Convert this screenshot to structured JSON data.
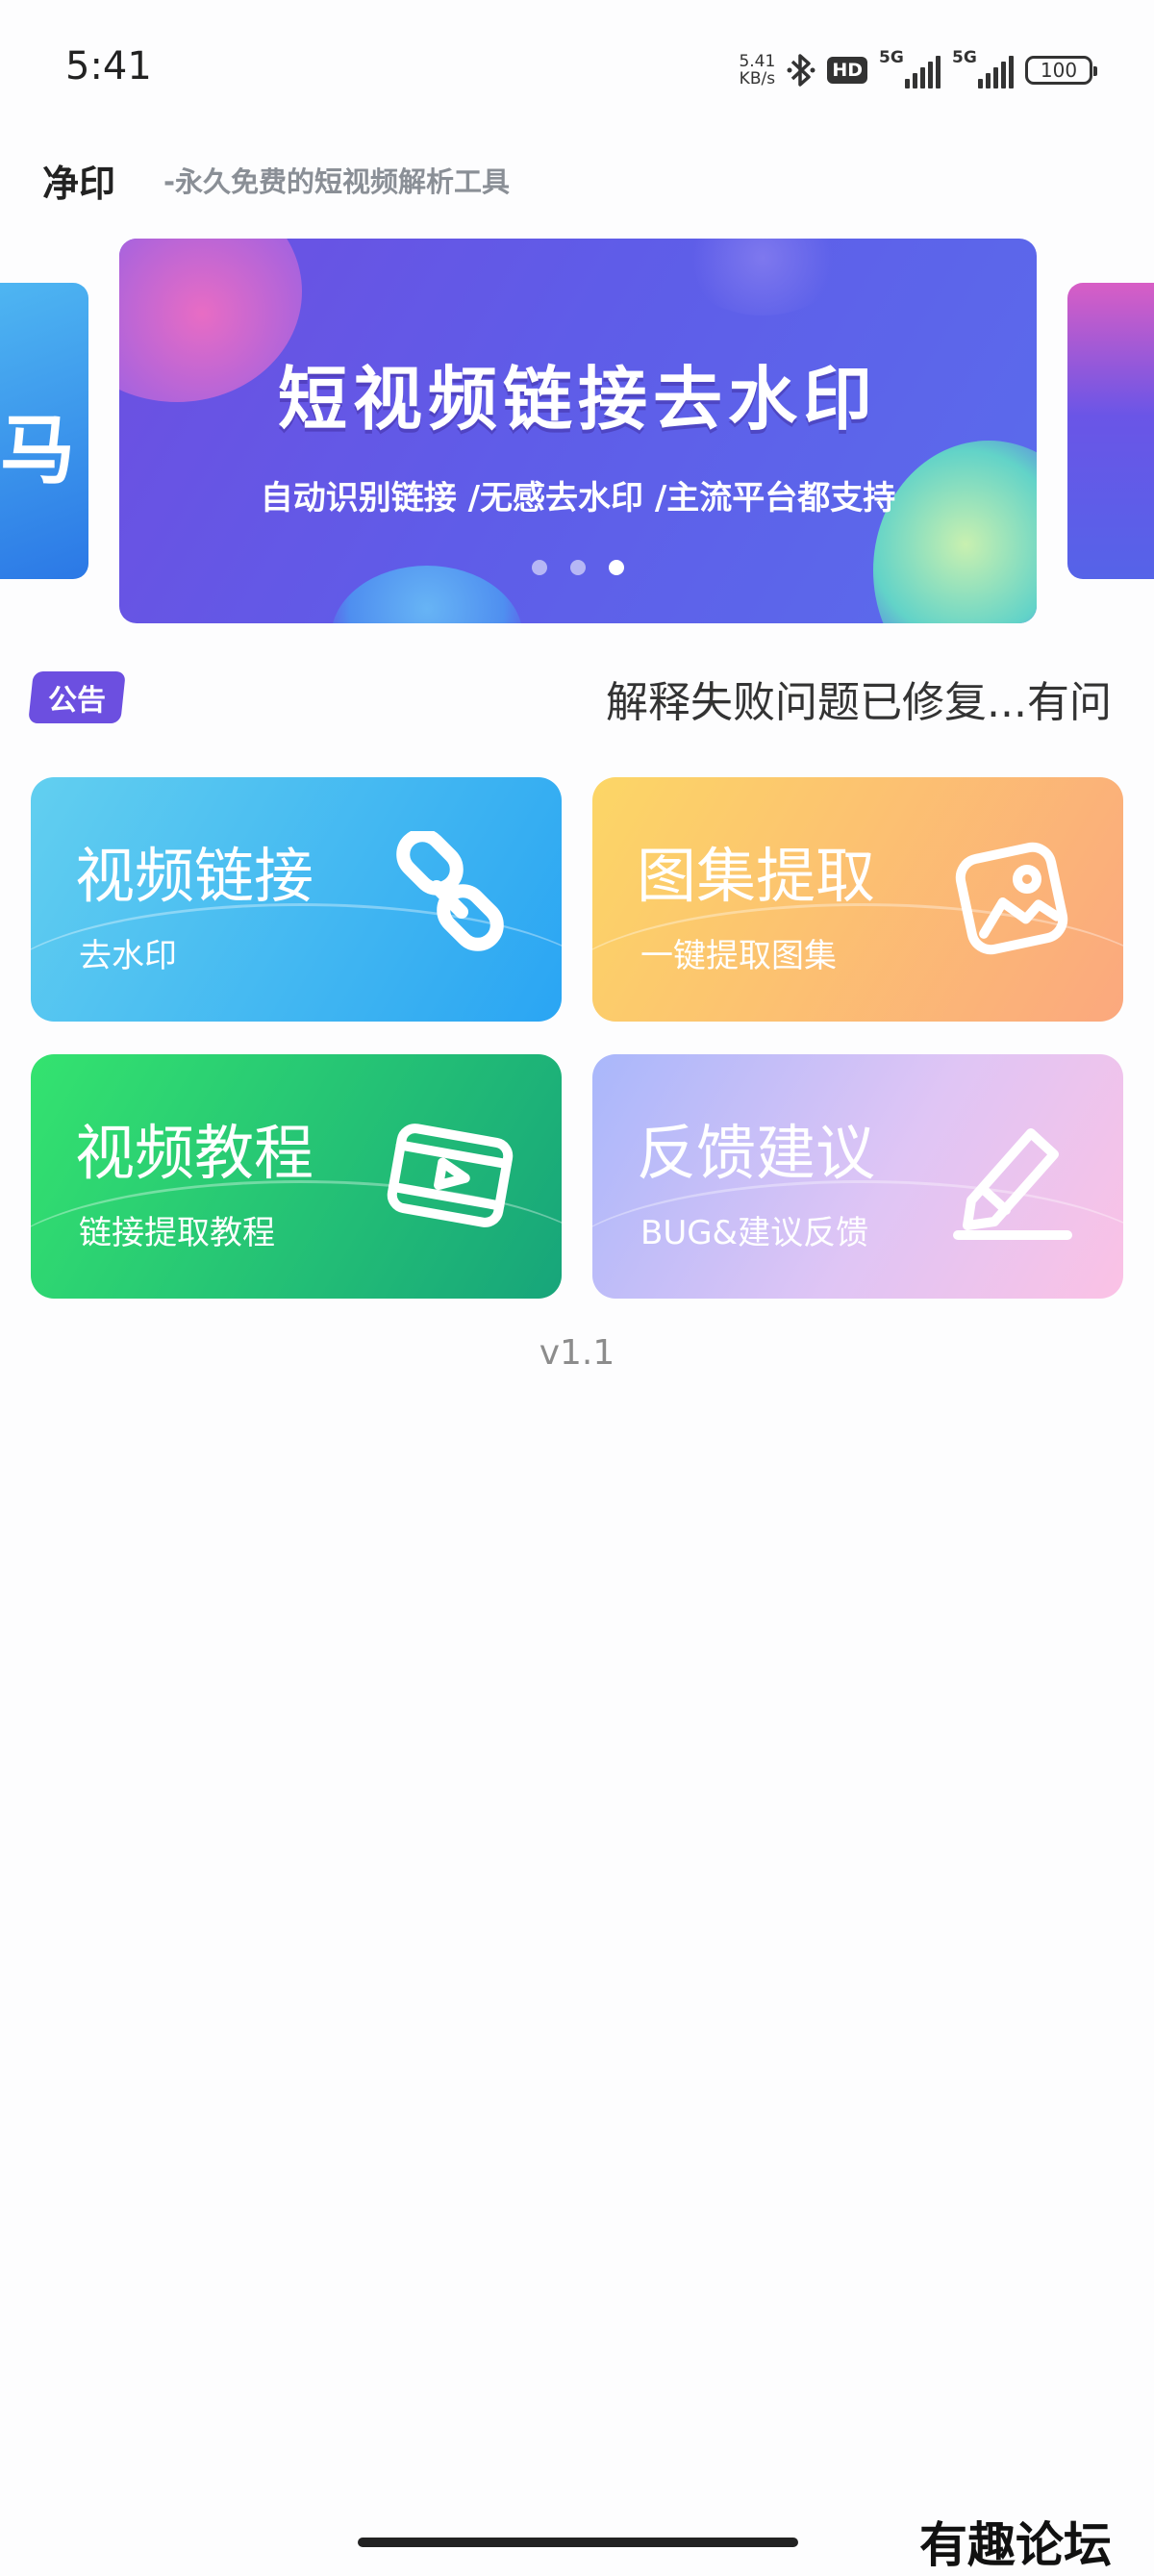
{
  "status_bar": {
    "time": "5:41",
    "net_speed_value": "5.41",
    "net_speed_unit": "KB/s",
    "hd_label": "HD",
    "sim1_label": "5G",
    "sim2_label": "5G",
    "battery": "100"
  },
  "header": {
    "title": "净印",
    "subtitle": "-永久免费的短视频解析工具"
  },
  "banner": {
    "title": "短视频链接去水印",
    "subtitle": "自动识别链接 /无感去水印 /主流平台都支持",
    "left_peek_text": "马",
    "slide_count": 3,
    "active_slide": 3
  },
  "notice": {
    "badge": "公告",
    "text": "解释失败问题已修复...有问"
  },
  "cards": [
    {
      "title": "视频链接",
      "subtitle": "去水印",
      "icon": "link-icon",
      "gradient": [
        "#62cff0",
        "#2aa5f3"
      ]
    },
    {
      "title": "图集提取",
      "subtitle": "一键提取图集",
      "icon": "image-icon",
      "gradient": [
        "#fcd666",
        "#fba87e"
      ]
    },
    {
      "title": "视频教程",
      "subtitle": "链接提取教程",
      "icon": "video-play-icon",
      "gradient": [
        "#34e36f",
        "#17a57a"
      ]
    },
    {
      "title": "反馈建议",
      "subtitle": "BUG&建议反馈",
      "icon": "pencil-edit-icon",
      "gradient": [
        "#a9b7fb",
        "#fbc2e5"
      ]
    }
  ],
  "version": "v1.1",
  "watermark": "有趣论坛",
  "colors": {
    "accent": "#6c4fe0",
    "banner_start": "#6d4fe1",
    "banner_end": "#5a6cec"
  }
}
